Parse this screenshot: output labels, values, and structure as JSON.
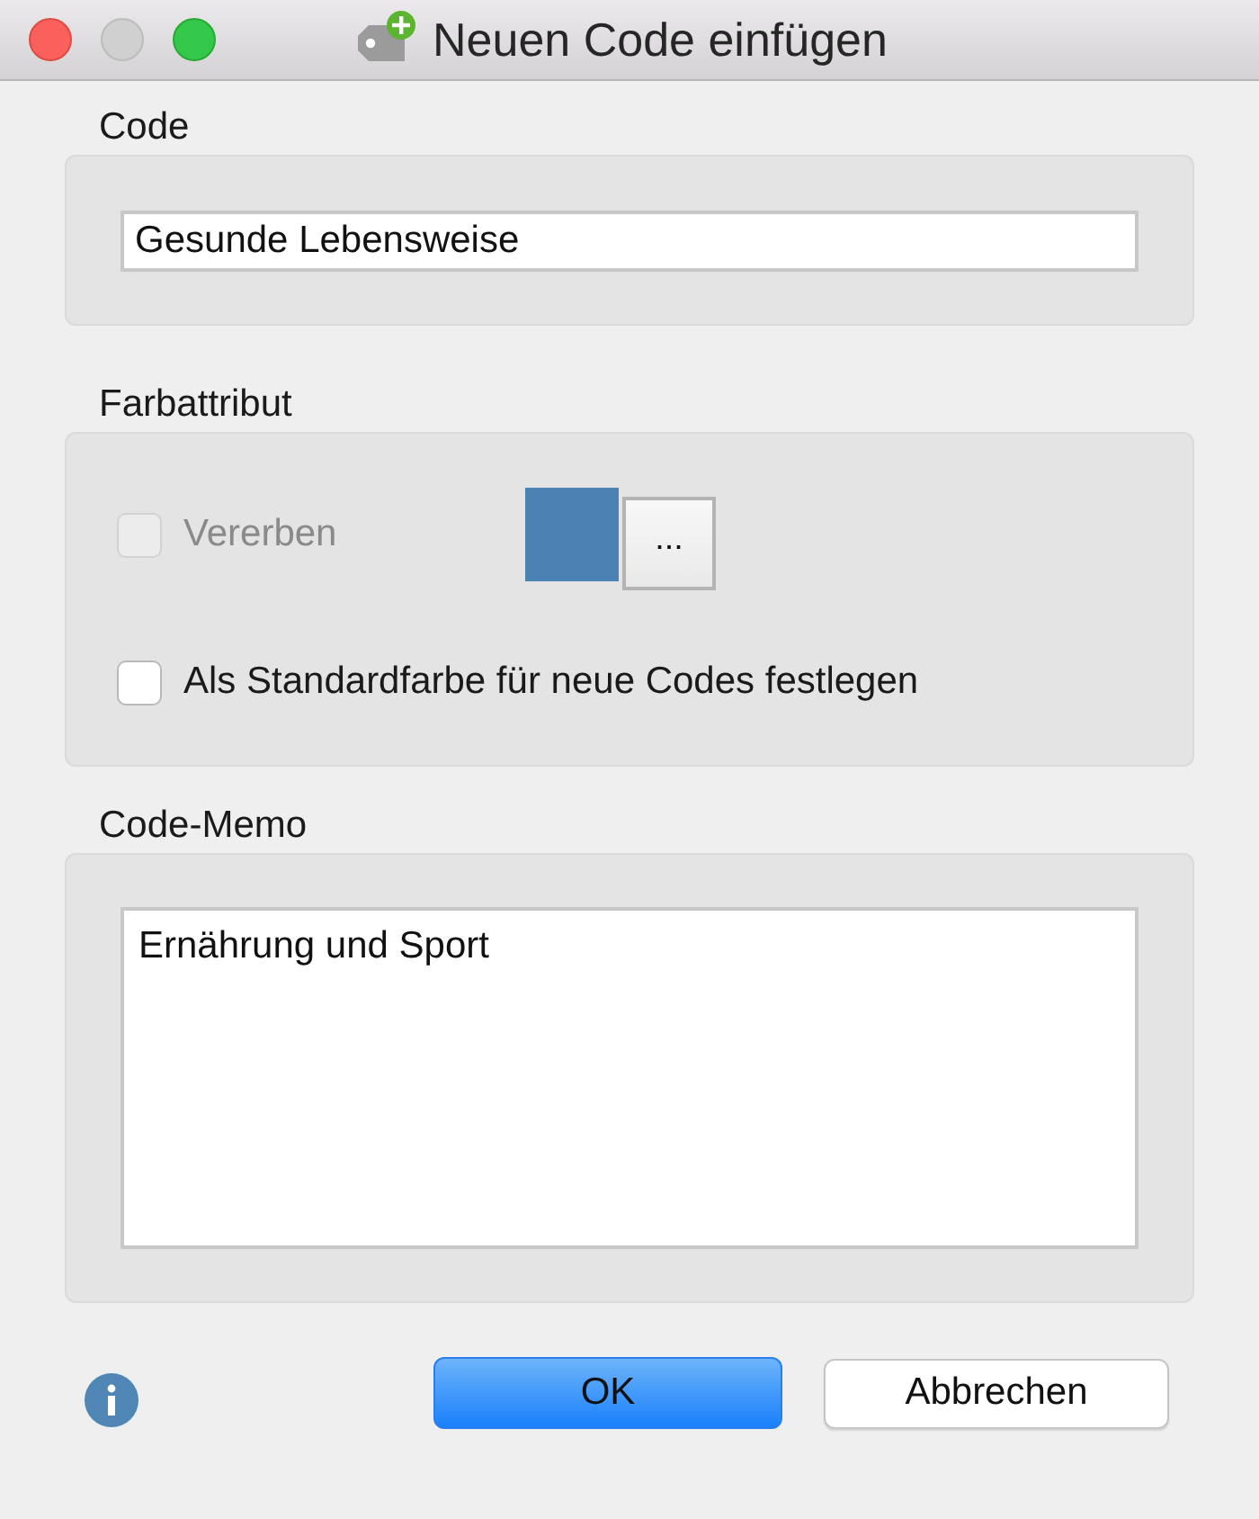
{
  "window": {
    "title": "Neuen Code einfügen",
    "controls": [
      {
        "kind": "close",
        "disabled": false
      },
      {
        "kind": "minimize",
        "disabled": true
      },
      {
        "kind": "zoom",
        "disabled": false
      }
    ]
  },
  "code": {
    "label": "Code",
    "value": "Gesunde Lebensweise"
  },
  "color_attribute": {
    "label": "Farbattribut",
    "inherit": {
      "label": "Vererben",
      "checked": false,
      "disabled": true
    },
    "swatch": {
      "color": "#4a83b3"
    },
    "picker_button": "...",
    "set_as_default": {
      "label": "Als Standardfarbe für neue Codes festlegen",
      "checked": false,
      "disabled": false
    }
  },
  "memo": {
    "label": "Code-Memo",
    "value": "Ernährung und Sport"
  },
  "buttons": [
    {
      "label": "OK",
      "kind": "default"
    },
    {
      "label": "Abbrechen",
      "kind": "cancel"
    }
  ]
}
